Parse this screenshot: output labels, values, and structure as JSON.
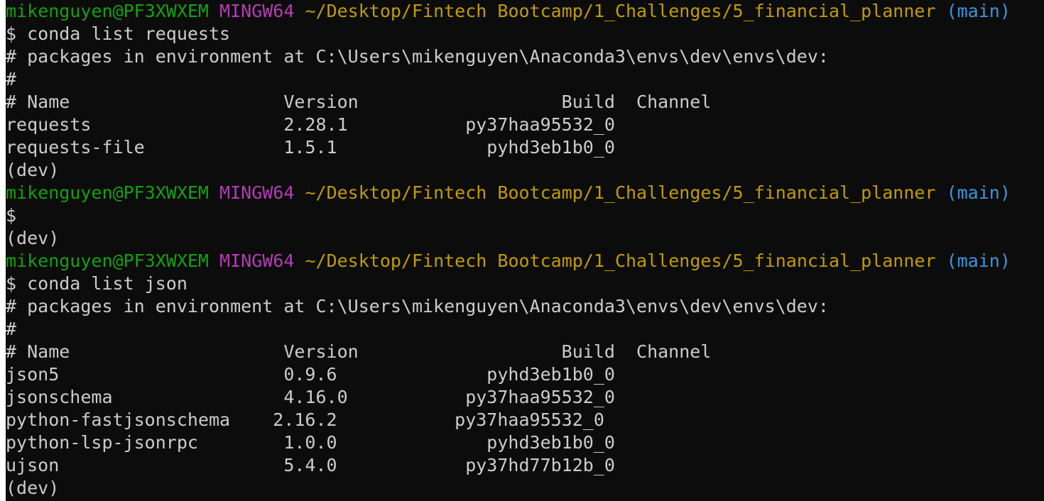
{
  "prompt": {
    "user_host": "mikenguyen@PF3XWXEM",
    "shell": "MINGW64",
    "cwd": "~/Desktop/Fintech Bootcamp/1_Challenges/5_financial_planner",
    "branch": "(main)"
  },
  "colors": {
    "background": "#0c0c0c",
    "text": "#cccccc",
    "user_host": "#13a10e",
    "shell": "#b43cb4",
    "cwd": "#c19c00",
    "branch": "#3a96dd"
  },
  "block1": {
    "command": "$ conda list requests",
    "env_line": "# packages in environment at C:\\Users\\mikenguyen\\Anaconda3\\envs\\dev\\envs\\dev:",
    "hash": "#",
    "header": "# Name                    Version                   Build  Channel",
    "rows": [
      "requests                  2.28.1           py37haa95532_0",
      "requests-file             1.5.1              pyhd3eb1b0_0"
    ],
    "env_marker": "(dev)"
  },
  "block2": {
    "command": "$",
    "env_marker": "(dev)"
  },
  "block3": {
    "command": "$ conda list json",
    "env_line": "# packages in environment at C:\\Users\\mikenguyen\\Anaconda3\\envs\\dev\\envs\\dev:",
    "hash": "#",
    "header": "# Name                    Version                   Build  Channel",
    "rows": [
      "json5                     0.9.6              pyhd3eb1b0_0",
      "jsonschema                4.16.0           py37haa95532_0",
      "python-fastjsonschema    2.16.2           py37haa95532_0",
      "python-lsp-jsonrpc        1.0.0              pyhd3eb1b0_0",
      "ujson                     5.4.0            py37hd77b12b_0"
    ],
    "env_marker": "(dev)"
  }
}
